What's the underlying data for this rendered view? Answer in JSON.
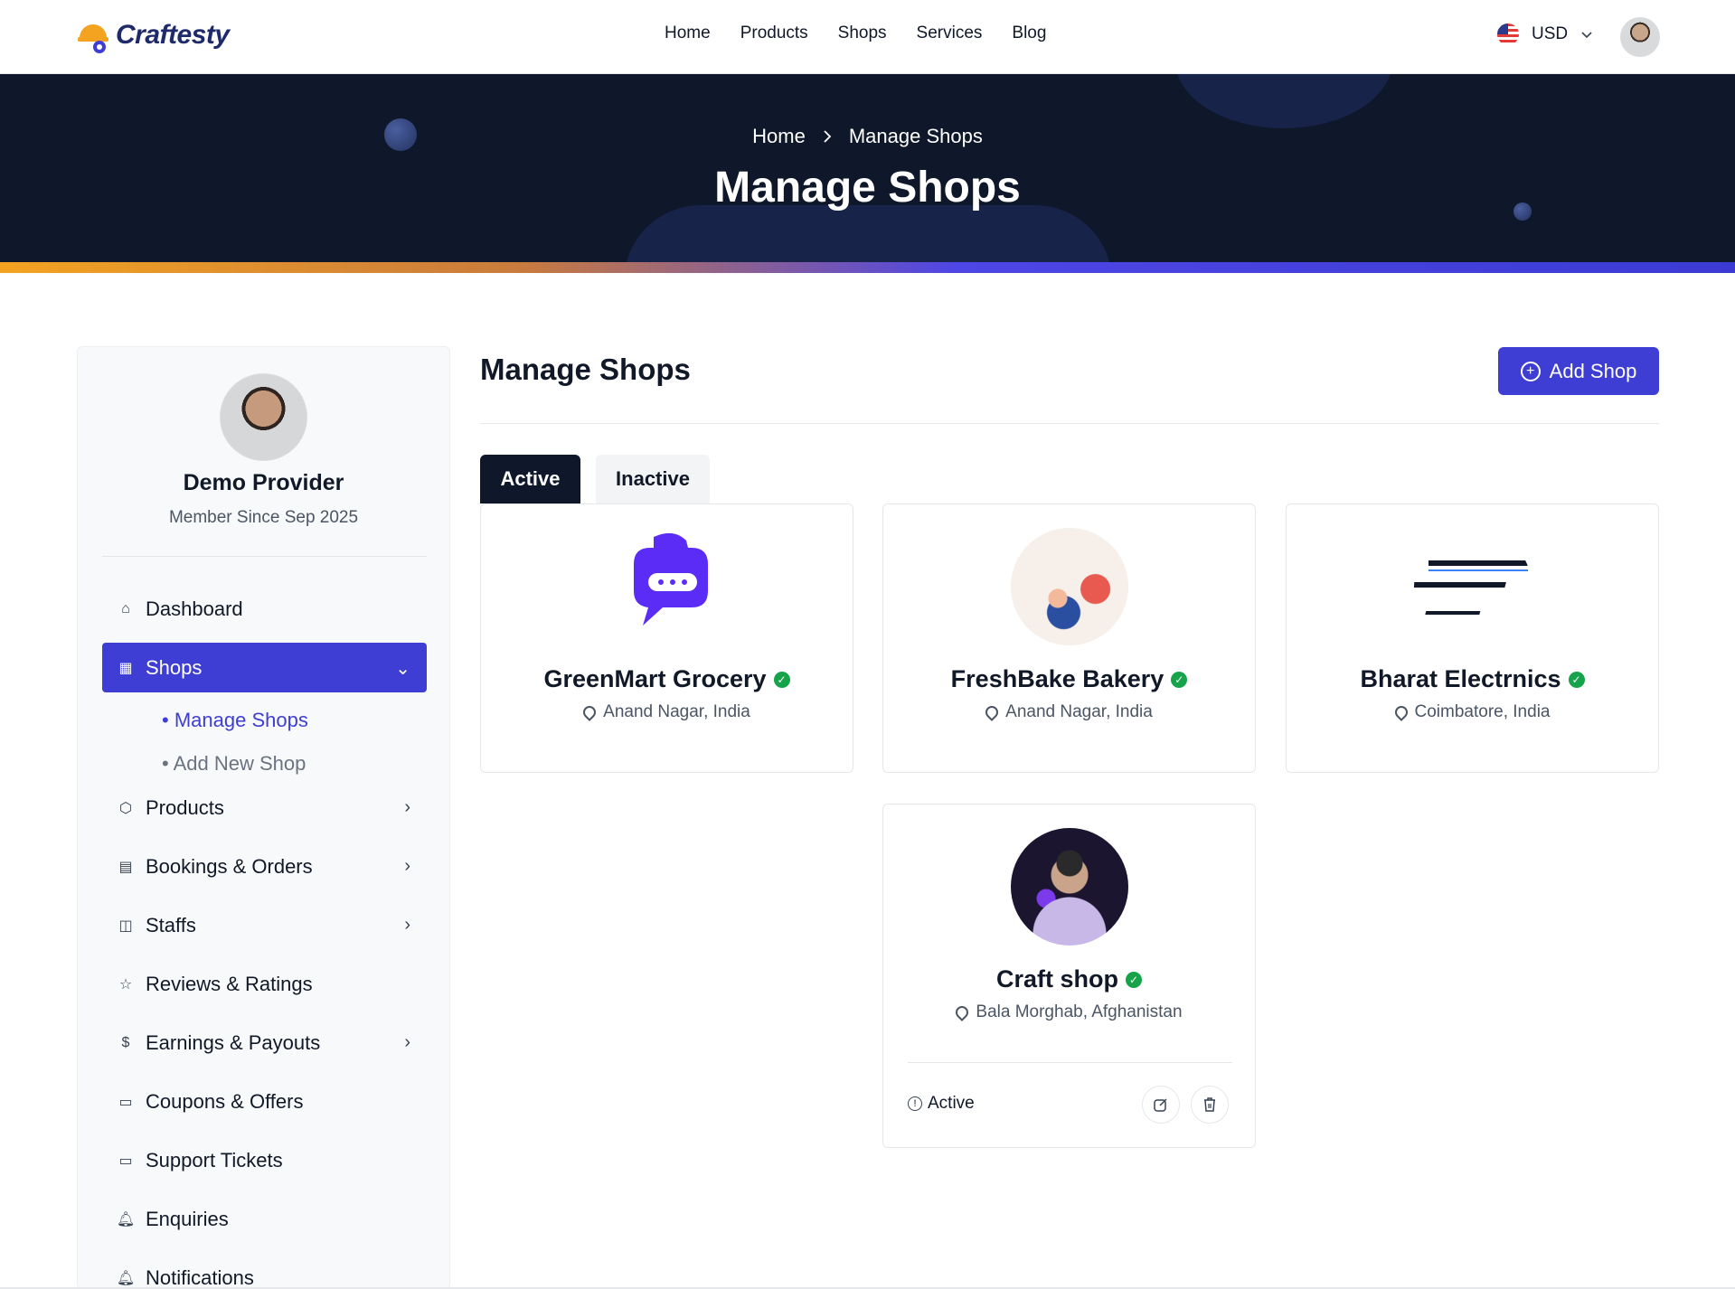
{
  "brand": {
    "name": "Craftesty"
  },
  "nav": [
    "Home",
    "Products",
    "Shops",
    "Services",
    "Blog"
  ],
  "currency": {
    "code": "USD"
  },
  "hero": {
    "breadcrumb": [
      "Home",
      "Manage Shops"
    ],
    "title": "Manage Shops"
  },
  "sidebar": {
    "user_name": "Demo Provider",
    "member_since": "Member Since Sep 2025",
    "items": [
      {
        "label": "Dashboard",
        "icon": "home-icon"
      },
      {
        "label": "Shops",
        "icon": "shop-icon"
      },
      {
        "label": "Products",
        "icon": "box-icon"
      },
      {
        "label": "Bookings & Orders",
        "icon": "calendar-icon"
      },
      {
        "label": "Staffs",
        "icon": "staff-icon"
      },
      {
        "label": "Reviews & Ratings",
        "icon": "star-icon"
      },
      {
        "label": "Earnings & Payouts",
        "icon": "dollar-icon"
      },
      {
        "label": "Coupons & Offers",
        "icon": "ticket-icon"
      },
      {
        "label": "Support Tickets",
        "icon": "ticket-icon"
      },
      {
        "label": "Enquiries",
        "icon": "bell-icon"
      },
      {
        "label": "Notifications",
        "icon": "bell-icon"
      }
    ],
    "shops_submenu": [
      "Manage Shops",
      "Add New Shop"
    ]
  },
  "main": {
    "title": "Manage Shops",
    "add_button": "Add Shop",
    "tabs": [
      "Active",
      "Inactive"
    ],
    "shops": [
      {
        "name": "GreenMart Grocery",
        "location": "Anand Nagar, India"
      },
      {
        "name": "FreshBake Bakery",
        "location": "Anand Nagar, India"
      },
      {
        "name": "Bharat Electrnics",
        "location": "Coimbatore, India"
      },
      {
        "name": "Craft shop",
        "location": "Bala Morghab, Afghanistan",
        "status": "Active"
      }
    ]
  },
  "colors": {
    "primary": "#3f3ed4",
    "hero_bg": "#0f172a",
    "verified": "#16a34a",
    "accent_orange": "#f4a321"
  }
}
